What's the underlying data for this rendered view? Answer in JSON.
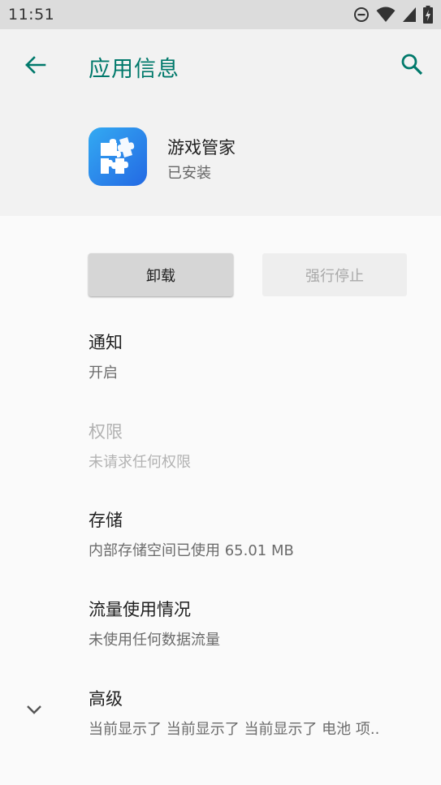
{
  "status_bar": {
    "time": "11:51",
    "icons": [
      "do-not-disturb-icon",
      "wifi-icon",
      "cell-signal-icon",
      "battery-charging-icon"
    ]
  },
  "header": {
    "title": "应用信息",
    "back_icon": "back-arrow-icon",
    "search_icon": "search-icon"
  },
  "app": {
    "name": "游戏管家",
    "status": "已安装",
    "icon": "puzzle-app-icon"
  },
  "actions": {
    "uninstall_label": "卸载",
    "force_stop_label": "强行停止",
    "force_stop_enabled": false
  },
  "items": [
    {
      "title": "通知",
      "subtitle": "开启",
      "enabled": true
    },
    {
      "title": "权限",
      "subtitle": "未请求任何权限",
      "enabled": false
    },
    {
      "title": "存储",
      "subtitle": "内部存储空间已使用 65.01 MB",
      "enabled": true
    },
    {
      "title": "流量使用情况",
      "subtitle": "未使用任何数据流量",
      "enabled": true
    },
    {
      "title": "高级",
      "subtitle": "当前显示了 当前显示了 当前显示了 电池 项..",
      "enabled": true,
      "icon": "chevron-down-icon"
    }
  ],
  "colors": {
    "accent": "#00796b",
    "status_bar_bg": "#dcdcdc",
    "header_bg": "#f2f2f2",
    "page_bg": "#fafafa",
    "app_icon_gradient": [
      "#33aaf2",
      "#2369e3"
    ]
  }
}
